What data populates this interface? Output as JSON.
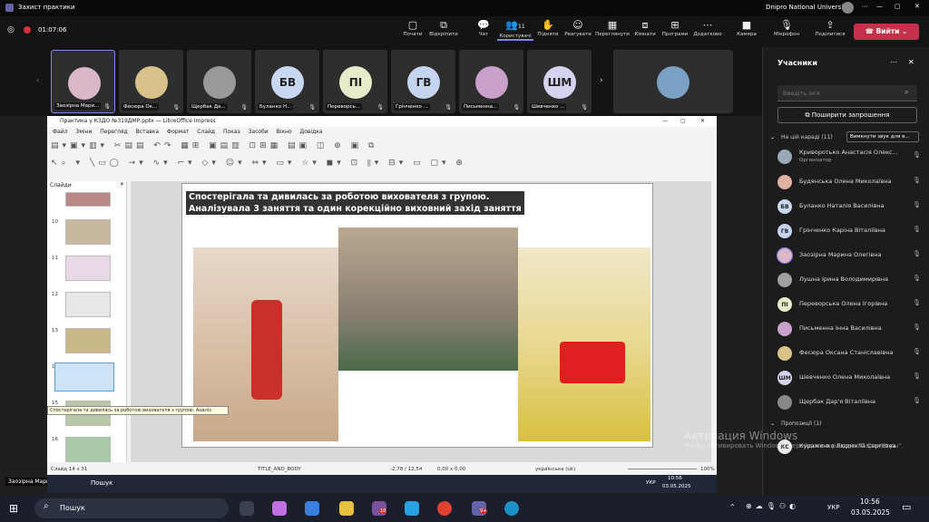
{
  "titlebar": {
    "app_title": "Захист практики",
    "org": "Dnipro National University"
  },
  "toolbar": {
    "timer": "01:07:06",
    "buttons": [
      {
        "label": "Почати",
        "icon": "▢"
      },
      {
        "label": "Відкріпити",
        "icon": "⧉"
      },
      {
        "label": "Чат",
        "icon": "💬"
      },
      {
        "label": "Користувачі",
        "icon": "👥",
        "badge": "11"
      },
      {
        "label": "Підняти",
        "icon": "✋"
      },
      {
        "label": "Реагувати",
        "icon": "☺"
      },
      {
        "label": "Переглянути",
        "icon": "▦"
      },
      {
        "label": "Кімнати",
        "icon": "⧈"
      },
      {
        "label": "Програми",
        "icon": "⊞"
      },
      {
        "label": "Додатково",
        "icon": "⋯"
      }
    ],
    "camera_label": "Камера",
    "mic_label": "Мікрофон",
    "share_label": "Поділитися",
    "leave_label": "Вийти"
  },
  "strip": {
    "tiles": [
      {
        "name": "Заозірна Мари...",
        "initials": "",
        "color": "#d9b7c9",
        "pic": true
      },
      {
        "name": "Фесюра Ок...",
        "initials": "",
        "color": "#d9c28a",
        "pic": true
      },
      {
        "name": "Щербак Да...",
        "initials": "",
        "color": "#999999",
        "pic": true
      },
      {
        "name": "Буланко Н...",
        "initials": "БВ",
        "color": "#c8d8f0",
        "pic": false
      },
      {
        "name": "Переворсь...",
        "initials": "ПІ",
        "color": "#e6ecc9",
        "pic": false
      },
      {
        "name": "Грінченко ...",
        "initials": "ГВ",
        "color": "#c4d4ee",
        "pic": false
      },
      {
        "name": "Письменна...",
        "initials": "",
        "color": "#c9a0c9",
        "pic": true
      },
      {
        "name": "Шевченко ...",
        "initials": "ШМ",
        "color": "#d4d4f0",
        "pic": false
      }
    ],
    "speaker_name": "Заозірна Марина Олегівна"
  },
  "sidebar": {
    "title": "Учасники",
    "search_placeholder": "Введіть ім'я",
    "invite_label": "Поширити запрошення",
    "in_meeting_label": "На цій нараді (11)",
    "mute_all_label": "Вимкнути звук для в...",
    "participants": [
      {
        "name": "Криворотько Анастасія Олекс...",
        "sub": "Організатор",
        "initials": "",
        "color": "#9aa8b8"
      },
      {
        "name": "Будянська Олена Миколаївна",
        "sub": "",
        "initials": "",
        "color": "#e0b0a0"
      },
      {
        "name": "Буланко Наталія Василівна",
        "sub": "",
        "initials": "БВ",
        "color": "#c8d8f0"
      },
      {
        "name": "Грінченко Каріна Віталіївна",
        "sub": "",
        "initials": "ГВ",
        "color": "#c4d4ee"
      },
      {
        "name": "Заозірна Марина Олегівна",
        "sub": "",
        "initials": "",
        "color": "#d9b7c9"
      },
      {
        "name": "Лушна Ірина Володимирівна",
        "sub": "",
        "initials": "",
        "color": "#a0a0a0"
      },
      {
        "name": "Переворська Олена Ігорівна",
        "sub": "",
        "initials": "ПІ",
        "color": "#e6ecc9"
      },
      {
        "name": "Письменна Інна Василівна",
        "sub": "",
        "initials": "",
        "color": "#c9a0c9"
      },
      {
        "name": "Фесюра Оксана Станіславівна",
        "sub": "",
        "initials": "",
        "color": "#d9c28a"
      },
      {
        "name": "Шевченко Олена Миколаївна",
        "sub": "",
        "initials": "ШМ",
        "color": "#d4d4f0"
      },
      {
        "name": "Щербак Дар'я Віталіївна",
        "sub": "",
        "initials": "",
        "color": "#888888"
      }
    ],
    "proposals_label": "Пропозиції (1)",
    "proposal": {
      "name": "Кураженко Людмила Сергіївна",
      "initials": "КС",
      "color": "#e8e8e8"
    }
  },
  "impress": {
    "title": "Практика у КЗДО №319ДМР.pptx — LibreOffice Impress",
    "menu": [
      "Файл",
      "Зміни",
      "Перегляд",
      "Вставка",
      "Формат",
      "Слайд",
      "Показ",
      "Засоби",
      "Вікно",
      "Довідка"
    ],
    "slides_label": "Слайди",
    "thumb_numbers": [
      "10",
      "11",
      "12",
      "13",
      "14",
      "15",
      "16"
    ],
    "tooltip": "Спостерігала та дивилась за роботою вихователя з групою. Аналіз",
    "slide_text_1": "Спостерігала та дивилась за роботою вихователя з групою.",
    "slide_text_2": "Аналізувала  3 заняття та один  корекційно виховний захід заняття",
    "status_slide": "Слайд 14 з 31",
    "status_layout": "TITLE_AND_BODY",
    "status_pos": "-2,78 / 12,54",
    "status_size": "0,00 x 0,00",
    "status_lang": "українська (uk)",
    "status_zoom": "100%",
    "inner_time": "10:56",
    "inner_date": "03.05.2025",
    "inner_lang": "УКР",
    "inner_search": "Пошук"
  },
  "watermark": {
    "title": "Активация Windows",
    "sub": "Чтобы активировать Windows, перейдите в раздел \"Параметры\"."
  },
  "taskbar": {
    "search": "Пошук",
    "lang": "УКР",
    "time": "10:56",
    "date": "03.05.2025",
    "badge1": "18",
    "badge2": "9+"
  }
}
